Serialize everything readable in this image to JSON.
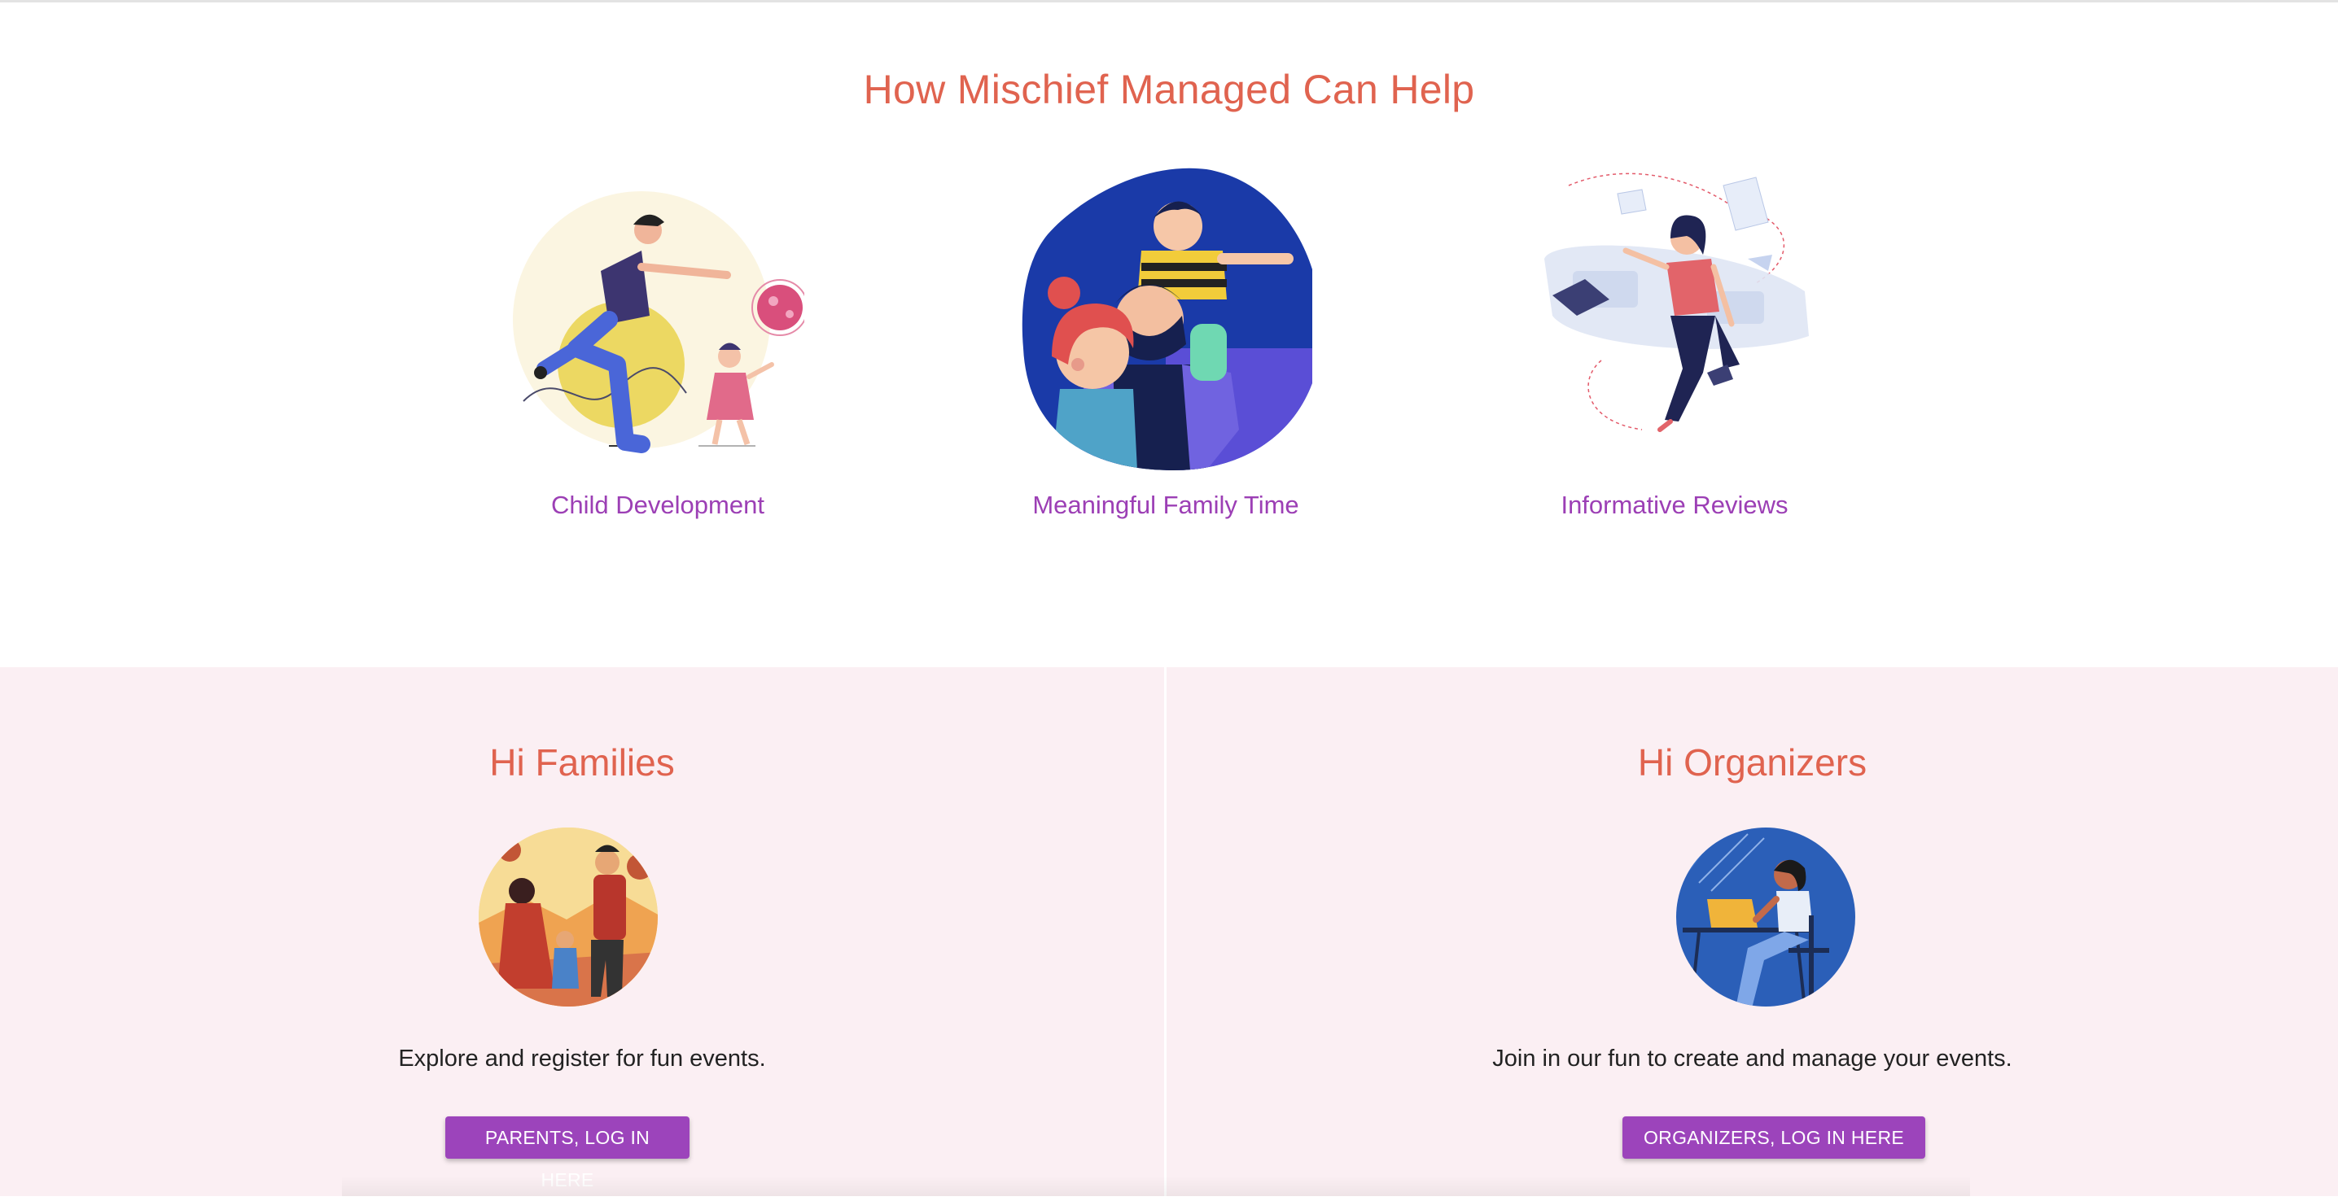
{
  "help": {
    "title": "How Mischief Managed Can Help",
    "features": [
      {
        "label": "Child Development",
        "icon": "parent-child-play-illustration"
      },
      {
        "label": "Meaningful Family Time",
        "icon": "family-hug-illustration"
      },
      {
        "label": "Informative Reviews",
        "icon": "woman-reviews-illustration"
      }
    ]
  },
  "families": {
    "title": "Hi Families",
    "text": "Explore and register for fun events.",
    "button_label": "PARENTS, LOG IN HERE",
    "icon": "family-walking-illustration"
  },
  "organizers": {
    "title": "Hi Organizers",
    "text": "Join in our fun to create and manage your events.",
    "button_label": "ORGANIZERS, LOG IN HERE",
    "icon": "organizer-laptop-illustration"
  },
  "colors": {
    "heading": "#e0634f",
    "feature_label": "#9c3fb5",
    "button": "#9c44bb",
    "bottom_bg": "#fbeff3"
  }
}
